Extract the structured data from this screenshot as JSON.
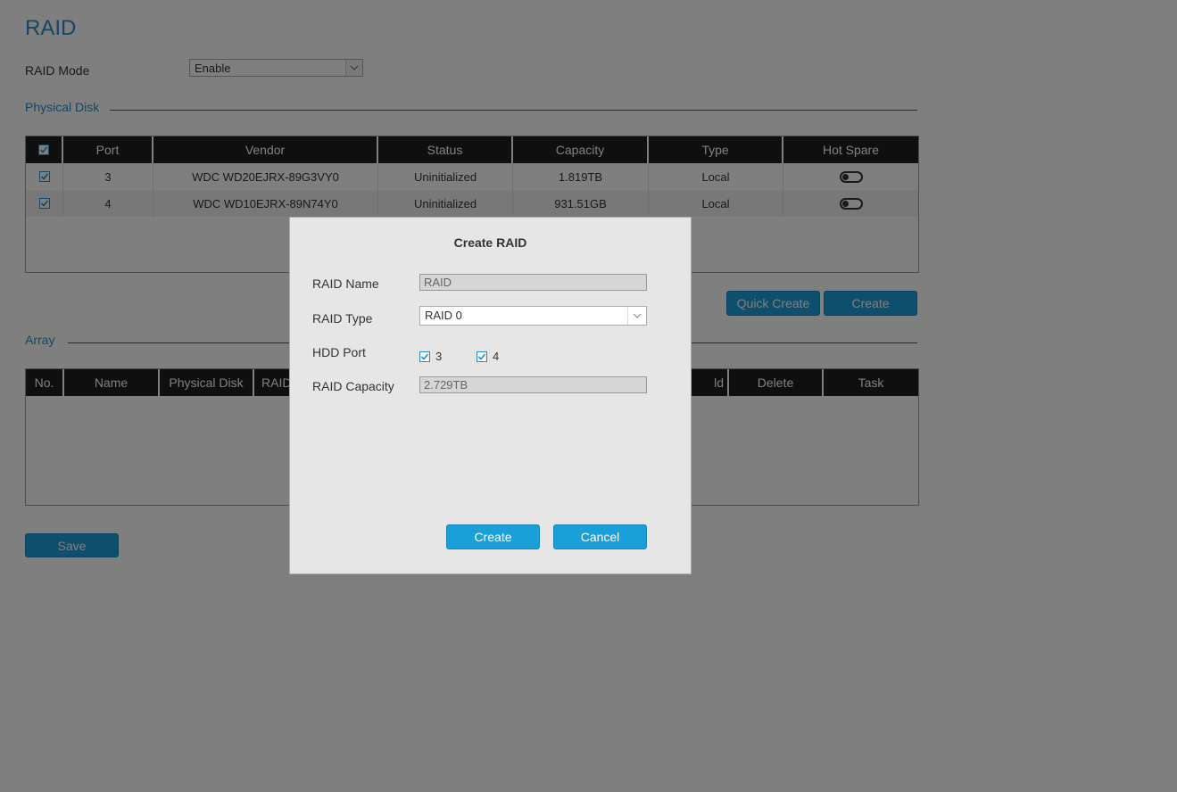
{
  "page": {
    "title": "RAID",
    "raid_mode": {
      "label": "RAID Mode",
      "value": "Enable"
    },
    "physical_disk_section": "Physical Disk",
    "array_section": "Array",
    "buttons": {
      "quick_create": "Quick Create",
      "create": "Create",
      "save": "Save"
    }
  },
  "physical_disk_table": {
    "headers": [
      "Port",
      "Vendor",
      "Status",
      "Capacity",
      "Type",
      "Hot Spare"
    ],
    "rows": [
      {
        "port": "3",
        "vendor": "WDC WD20EJRX-89G3VY0",
        "status": "Uninitialized",
        "capacity": "1.819TB",
        "type": "Local"
      },
      {
        "port": "4",
        "vendor": "WDC WD10EJRX-89N74Y0",
        "status": "Uninitialized",
        "capacity": "931.51GB",
        "type": "Local"
      }
    ]
  },
  "array_table": {
    "headers": [
      "No.",
      "Name",
      "Physical Disk",
      "RAID",
      "ld",
      "Delete",
      "Task"
    ]
  },
  "dialog": {
    "title": "Create RAID",
    "raid_name": {
      "label": "RAID Name",
      "value": "RAID"
    },
    "raid_type": {
      "label": "RAID Type",
      "value": "RAID 0"
    },
    "hdd_port": {
      "label": "HDD Port",
      "ports": [
        "3",
        "4"
      ]
    },
    "raid_capacity": {
      "label": "RAID Capacity",
      "value": "2.729TB"
    },
    "create_button": "Create",
    "cancel_button": "Cancel"
  },
  "colors": {
    "accent": "#2a8fc4",
    "button": "#1a9fd9",
    "header": "#1f1f1f"
  },
  "icons": [
    "checkbox-checked-icon",
    "chevron-down-icon",
    "toggle-off-icon"
  ]
}
